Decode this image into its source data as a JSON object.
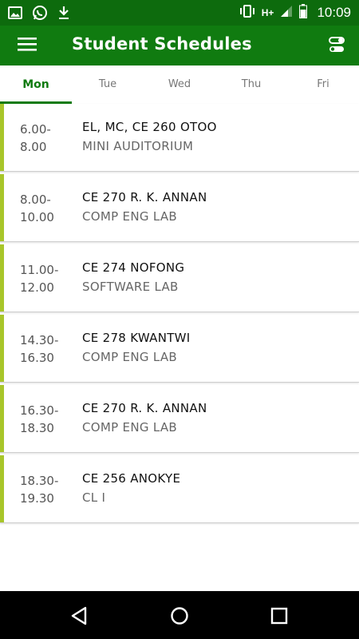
{
  "status_bar": {
    "time": "10:09",
    "network_label": "H+",
    "icons": [
      "image-icon",
      "whatsapp-icon",
      "download-icon",
      "vibrate-icon",
      "network-hplus-icon",
      "signal-icon",
      "battery-icon"
    ]
  },
  "app_bar": {
    "title": "Student Schedules",
    "icons": [
      "menu-icon",
      "filter-toggle-icon"
    ]
  },
  "tabs": [
    {
      "label": "Mon"
    },
    {
      "label": "Tue"
    },
    {
      "label": "Wed"
    },
    {
      "label": "Thu"
    },
    {
      "label": "Fri"
    }
  ],
  "active_tab": "Mon",
  "schedule": [
    {
      "time_start": "6.00-",
      "time_end": "8.00",
      "course": "EL, MC, CE 260 OTOO",
      "room": "MINI AUDITORIUM"
    },
    {
      "time_start": "8.00-",
      "time_end": "10.00",
      "course": "CE 270 R. K. ANNAN",
      "room": "COMP ENG LAB"
    },
    {
      "time_start": "11.00-",
      "time_end": "12.00",
      "course": "CE 274 NOFONG",
      "room": "SOFTWARE LAB"
    },
    {
      "time_start": "14.30-",
      "time_end": "16.30",
      "course": "CE 278 KWANTWI",
      "room": "COMP ENG LAB"
    },
    {
      "time_start": "16.30-",
      "time_end": "18.30",
      "course": "CE 270 R. K. ANNAN",
      "room": "COMP ENG LAB"
    },
    {
      "time_start": "18.30-",
      "time_end": "19.30",
      "course": "CE 256 ANOKYE",
      "room": "CL I"
    }
  ],
  "colors": {
    "status_bar": "#0d6b0d",
    "app_bar": "#107b10",
    "accent": "#a8c62a",
    "active_tab": "#107b10"
  },
  "nav_bar": {
    "icons": [
      "back-icon",
      "home-icon",
      "recents-icon"
    ]
  }
}
